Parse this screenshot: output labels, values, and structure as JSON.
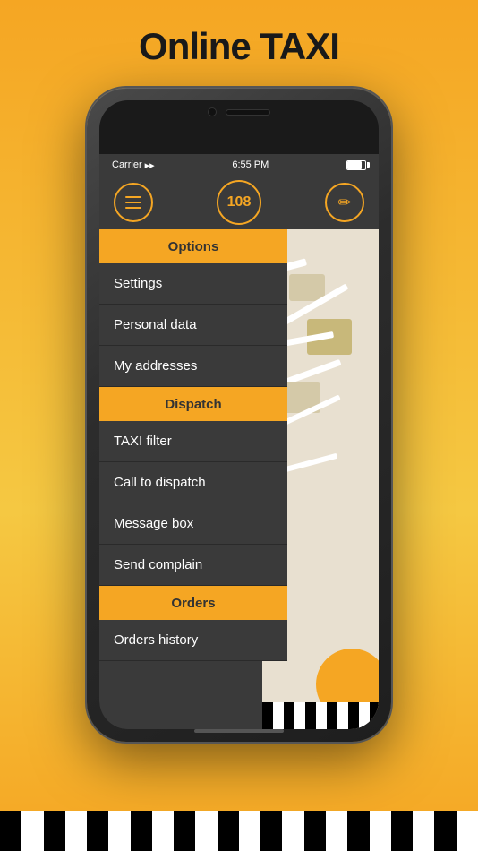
{
  "page": {
    "title": "Online TAXI"
  },
  "status_bar": {
    "carrier": "Carrier",
    "time": "6:55 PM"
  },
  "header": {
    "counter": "108",
    "hamburger_label": "menu",
    "edit_label": "edit"
  },
  "menu": {
    "sections": [
      {
        "type": "header",
        "label": "Options"
      },
      {
        "type": "item",
        "label": "Settings"
      },
      {
        "type": "item",
        "label": "Personal data"
      },
      {
        "type": "item",
        "label": "My addresses"
      },
      {
        "type": "header",
        "label": "Dispatch"
      },
      {
        "type": "item",
        "label": "TAXI filter"
      },
      {
        "type": "item",
        "label": "Call to dispatch"
      },
      {
        "type": "item",
        "label": "Message box"
      },
      {
        "type": "item",
        "label": "Send complain"
      },
      {
        "type": "header",
        "label": "Orders"
      },
      {
        "type": "item",
        "label": "Orders history"
      }
    ]
  },
  "colors": {
    "accent": "#f5a623",
    "dark_bg": "#3a3a3a",
    "text_light": "#ffffff",
    "text_dark": "#333333"
  }
}
